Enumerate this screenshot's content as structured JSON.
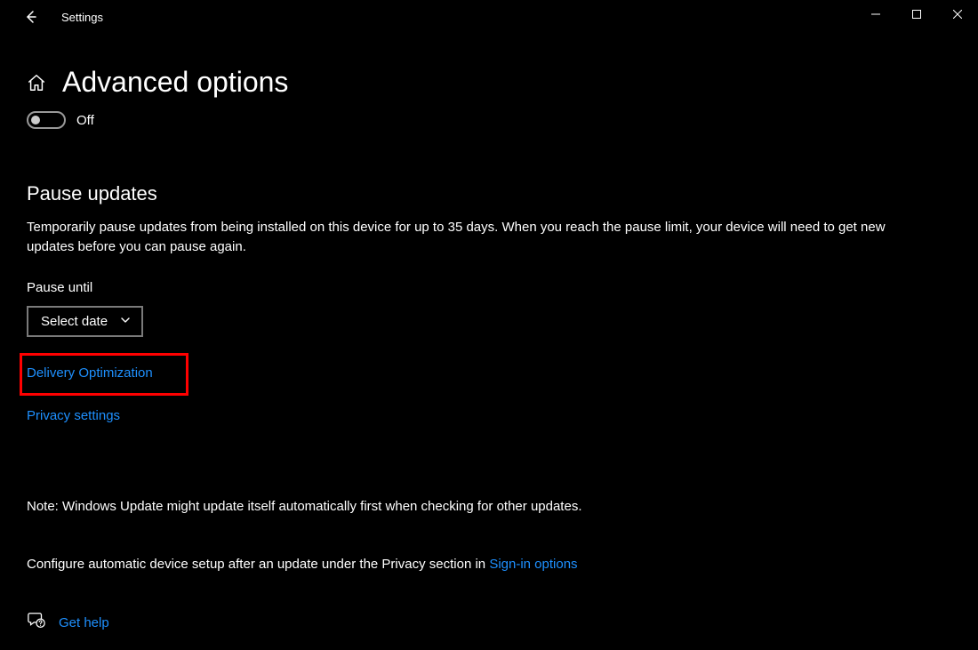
{
  "titlebar": {
    "title": "Settings"
  },
  "page": {
    "title": "Advanced options"
  },
  "toggle": {
    "label": "Off"
  },
  "pause": {
    "heading": "Pause updates",
    "description": "Temporarily pause updates from being installed on this device for up to 35 days. When you reach the pause limit, your device will need to get new updates before you can pause again.",
    "until_label": "Pause until",
    "select_label": "Select date"
  },
  "links": {
    "delivery_optimization": "Delivery Optimization",
    "privacy_settings": "Privacy settings",
    "signin_options": "Sign-in options",
    "get_help": "Get help"
  },
  "note": "Note: Windows Update might update itself automatically first when checking for other updates.",
  "configure_text": "Configure automatic device setup after an update under the Privacy section in "
}
